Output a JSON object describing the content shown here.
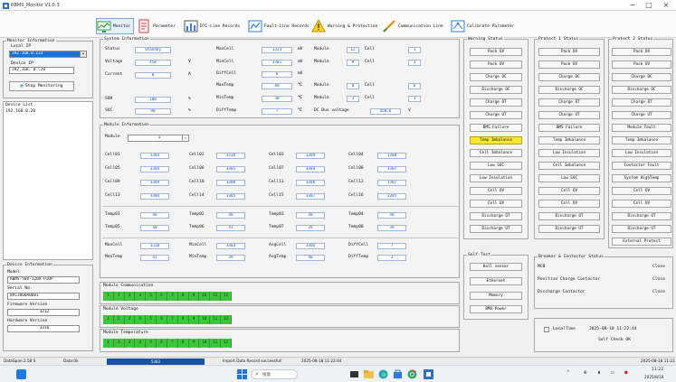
{
  "window": {
    "title": "RBMS_Monitor V1.0.3",
    "minimize": "−",
    "maximize": "□",
    "close": "×"
  },
  "toolbar": [
    {
      "label": "Monitor"
    },
    {
      "label": "Parameter"
    },
    {
      "label": "DTC-Line Records"
    },
    {
      "label": "Fault-Line Records"
    },
    {
      "label": "Warning & Protection"
    },
    {
      "label": "Communication Line"
    },
    {
      "label": "Calibrate Parameter"
    }
  ],
  "monitor_info": {
    "title": "Monitor Information",
    "local_ip_label": "Local IP",
    "local_ip_value": "192.168.0.123",
    "device_ip_label": "Device IP",
    "device_ip_value": "192.168. 0 .20",
    "stop_button": "Stop Monitoring"
  },
  "device_list": {
    "title": "Device List",
    "items": [
      "192.168.0.20"
    ]
  },
  "device_info": {
    "title": "Device Information",
    "model_label": "Model",
    "model_value": "RBMS-50V-120A-P10P",
    "serial_label": "Serial No.",
    "serial_value": "8913060A0b01",
    "fw_label": "Firmware Version",
    "fw_value": "3212",
    "hw_label": "Hardware Version",
    "hw_value": "3316"
  },
  "system_info": {
    "title": "System Information",
    "status_label": "Status",
    "status_value": "Standby",
    "voltage_label": "Voltage",
    "voltage_value": "458",
    "voltage_unit": "V",
    "current_label": "Current",
    "current_value": "0",
    "current_unit": "A",
    "soh_label": "SOH",
    "soh_value": "100",
    "soh_unit": "%",
    "soc_label": "SOC",
    "soc_value": "90",
    "soc_unit": "%",
    "maxcell_label": "MaxCell",
    "maxcell_value": "3323",
    "maxcell_unit": "mV",
    "mincell_label": "MinCell",
    "mincell_value": "3301",
    "mincell_unit": "mV",
    "diffcell_label": "DiffCell",
    "diffcell_value": "6",
    "diffcell_unit": "mV",
    "maxtemp_label": "MaxTemp",
    "maxtemp_value": "40",
    "maxtemp_unit": "℃",
    "mintemp_label": "MinTemp",
    "mintemp_value": "30",
    "mintemp_unit": "℃",
    "difftemp_label": "DiffTemp",
    "difftemp_value": "7",
    "difftemp_unit": "℃",
    "module_label": "Module",
    "cell_label": "Cell",
    "r1_module": "12",
    "r1_cell": "1",
    "r2_module": "9",
    "r2_cell": "1",
    "r3_module": "8",
    "r3_cell": "6",
    "r4_module": "1",
    "r4_cell": "3",
    "dcbus_label": "DC Bus voltage",
    "dcbus_value": "458.0",
    "dcbus_unit": "V"
  },
  "module_info": {
    "title": "Module Information",
    "module_label": "Module",
    "module_value": "1",
    "cells": [
      {
        "label": "Cell01",
        "value": "3304"
      },
      {
        "label": "Cell02",
        "value": "3310"
      },
      {
        "label": "Cell03",
        "value": "3309"
      },
      {
        "label": "Cell04",
        "value": "3308"
      },
      {
        "label": "Cell05",
        "value": "3304"
      },
      {
        "label": "Cell06",
        "value": "3305"
      },
      {
        "label": "Cell07",
        "value": "3304"
      },
      {
        "label": "Cell08",
        "value": "3307"
      },
      {
        "label": "Cell09",
        "value": "3304"
      },
      {
        "label": "Cell10",
        "value": "3308"
      },
      {
        "label": "Cell11",
        "value": "3306"
      },
      {
        "label": "Cell12",
        "value": "3307"
      },
      {
        "label": "Cell13",
        "value": "3304"
      },
      {
        "label": "Cell14",
        "value": "3305"
      },
      {
        "label": "Cell15",
        "value": "3307"
      },
      {
        "label": "Cell16",
        "value": "3305"
      }
    ],
    "temps": [
      {
        "label": "Temp01",
        "value": "40"
      },
      {
        "label": "Temp02",
        "value": "40"
      },
      {
        "label": "Temp03",
        "value": "40"
      },
      {
        "label": "Temp04",
        "value": "40"
      },
      {
        "label": "Temp05",
        "value": "40"
      },
      {
        "label": "Temp06",
        "value": "41"
      },
      {
        "label": "Temp07",
        "value": "39"
      },
      {
        "label": "Temp08",
        "value": "39"
      }
    ],
    "summary": [
      {
        "label": "MaxCell",
        "value": "3310"
      },
      {
        "label": "MinCell",
        "value": "3303"
      },
      {
        "label": "AvgCell",
        "value": "3306"
      },
      {
        "label": "DiffCell",
        "value": "7"
      },
      {
        "label": "MaxTemp",
        "value": "41"
      },
      {
        "label": "MinTemp",
        "value": "39"
      },
      {
        "label": "AvgTemp",
        "value": "40"
      },
      {
        "label": "DiffTemp",
        "value": "2"
      }
    ]
  },
  "bars": [
    {
      "title": "Module Communication",
      "cells": [
        "1",
        "2",
        "3",
        "4",
        "5",
        "6",
        "7",
        "8",
        "9",
        "10",
        "11",
        "12"
      ]
    },
    {
      "title": "Module Voltage",
      "cells": [
        "1",
        "2",
        "3",
        "4",
        "5",
        "6",
        "7",
        "8",
        "9",
        "10",
        "11",
        "12"
      ]
    },
    {
      "title": "Module Temperature",
      "cells": [
        "1",
        "2",
        "3",
        "4",
        "5",
        "6",
        "7",
        "8",
        "9",
        "10",
        "11",
        "12"
      ]
    }
  ],
  "warning_status": {
    "title": "Warning Status",
    "items": [
      "Pack OV",
      "Pack UV",
      "Charge OC",
      "Discharge OC",
      "Charge OT",
      "Charge UT",
      "BMS Failure",
      "Temp Imbalance",
      "Cell Imbalance",
      "Low SOC",
      "Low Insulation",
      "Cell OV",
      "Cell UV",
      "Discharge OT",
      "Discharge UT"
    ]
  },
  "protect1": {
    "title": "Protect 1 Status",
    "items": [
      "Pack OV",
      "Pack UV",
      "Charge OC",
      "Discharge OC",
      "Charge OT",
      "Charge UT",
      "BMS Failure",
      "Temp Imbalance",
      "Low Insulation",
      "Cell Imbalance",
      "Low SOC",
      "Cell OV",
      "Cell UV",
      "Discharge OT",
      "Discharge UT"
    ]
  },
  "protect2": {
    "title": "Protect 2 Status",
    "items": [
      "Pack OV",
      "Pack UV",
      "Charge OC",
      "Discharge OC",
      "Charge OT",
      "Charge UT",
      "Module Fault",
      "Temp Imbalance",
      "Low Insulation",
      "Contactor Fault",
      "System HighTemp",
      "Cell OV",
      "Cell UV",
      "Discharge OT",
      "Discharge UT",
      "External Protect"
    ]
  },
  "self_test": {
    "title": "Self-Test",
    "items": [
      "Hall sensor",
      "Ethernet",
      "Memory",
      "BMU Power"
    ]
  },
  "breaker": {
    "title": "Breaker & Contactor Status",
    "rows": [
      {
        "label": "MCB",
        "value": "Close"
      },
      {
        "label": "Positive Charge Contactor",
        "value": "Close"
      },
      {
        "label": "Discharge Contactor",
        "value": "Close"
      }
    ]
  },
  "check": {
    "localtime_label": "LocalTime",
    "localtime_value": "2025-08-18 11:22:44",
    "self_check": "Self Check OK"
  },
  "statusbar": {
    "left1": "DataSpan:2.58 S",
    "left2": "Data:0k",
    "mid": "5303",
    "msg": "Import Data Record successful!",
    "time": "2025-08-18 11:22:44",
    "right": "2025-08-18 11:22"
  },
  "taskbar": {
    "search": "搜索",
    "clock_time": "11:22",
    "clock_date": "2025/8/18"
  }
}
